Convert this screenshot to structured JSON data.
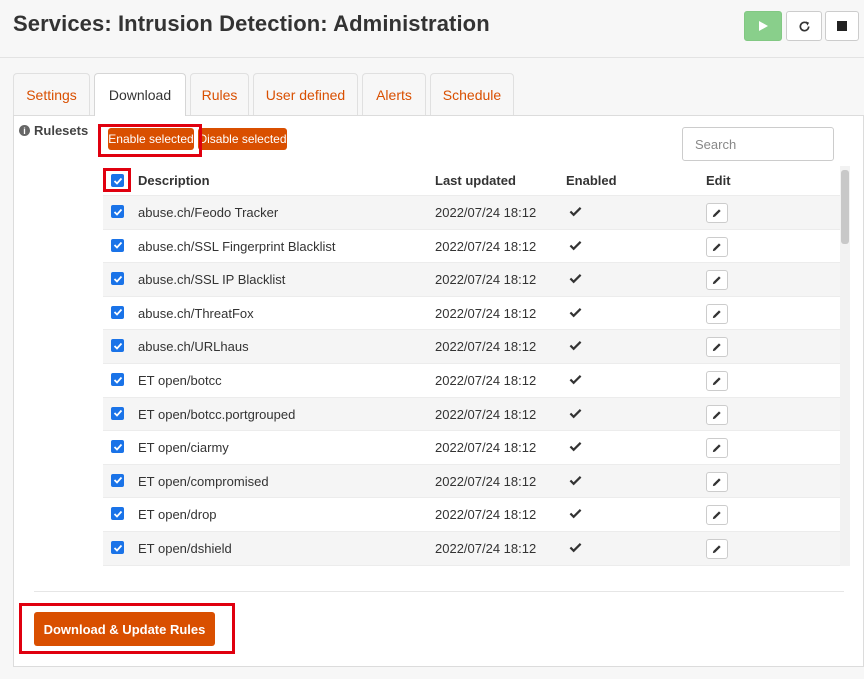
{
  "page": {
    "title": "Services: Intrusion Detection: Administration"
  },
  "header_buttons": {
    "play_icon": "play-icon",
    "reload_icon": "reload-icon",
    "stop_icon": "stop-icon"
  },
  "tabs": [
    {
      "label": "Settings"
    },
    {
      "label": "Download"
    },
    {
      "label": "Rules"
    },
    {
      "label": "User defined"
    },
    {
      "label": "Alerts"
    },
    {
      "label": "Schedule"
    }
  ],
  "active_tab": "Download",
  "rulesets": {
    "label": "Rulesets",
    "enable_selected_label": "Enable selected",
    "disable_selected_label": "Disable selected",
    "search_placeholder": "Search",
    "columns": {
      "description": "Description",
      "last_updated": "Last updated",
      "enabled": "Enabled",
      "edit": "Edit"
    },
    "select_all_checked": true,
    "rows": [
      {
        "description": "abuse.ch/Feodo Tracker",
        "last_updated": "2022/07/24 18:12",
        "enabled": true,
        "checked": true
      },
      {
        "description": "abuse.ch/SSL Fingerprint Blacklist",
        "last_updated": "2022/07/24 18:12",
        "enabled": true,
        "checked": true
      },
      {
        "description": "abuse.ch/SSL IP Blacklist",
        "last_updated": "2022/07/24 18:12",
        "enabled": true,
        "checked": true
      },
      {
        "description": "abuse.ch/ThreatFox",
        "last_updated": "2022/07/24 18:12",
        "enabled": true,
        "checked": true
      },
      {
        "description": "abuse.ch/URLhaus",
        "last_updated": "2022/07/24 18:12",
        "enabled": true,
        "checked": true
      },
      {
        "description": "ET open/botcc",
        "last_updated": "2022/07/24 18:12",
        "enabled": true,
        "checked": true
      },
      {
        "description": "ET open/botcc.portgrouped",
        "last_updated": "2022/07/24 18:12",
        "enabled": true,
        "checked": true
      },
      {
        "description": "ET open/ciarmy",
        "last_updated": "2022/07/24 18:12",
        "enabled": true,
        "checked": true
      },
      {
        "description": "ET open/compromised",
        "last_updated": "2022/07/24 18:12",
        "enabled": true,
        "checked": true
      },
      {
        "description": "ET open/drop",
        "last_updated": "2022/07/24 18:12",
        "enabled": true,
        "checked": true
      },
      {
        "description": "ET open/dshield",
        "last_updated": "2022/07/24 18:12",
        "enabled": true,
        "checked": true
      }
    ]
  },
  "actions": {
    "download_update_label": "Download & Update Rules"
  },
  "colors": {
    "accent": "#d94f00",
    "highlight": "#e0000f",
    "checkbox": "#1a73e8",
    "play": "#89cf8b"
  }
}
